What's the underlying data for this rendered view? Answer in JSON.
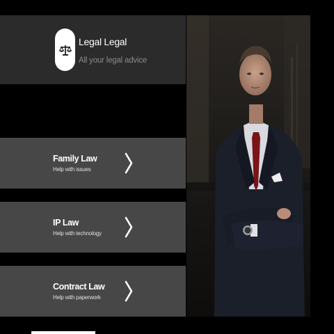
{
  "app": {
    "title": "Legal Legal",
    "tagline": "All your legal advice",
    "logo_icon": "scales-of-justice-icon"
  },
  "photo": {
    "subject": "man in dark suit with red tie, arms crossed",
    "icon": "lawyer-portrait-photo"
  },
  "services": [
    {
      "title": "Family Law",
      "subtitle": "Help with issues",
      "icon": "chevron-right-icon"
    },
    {
      "title": "IP Law",
      "subtitle": "Help with technology",
      "icon": "chevron-right-icon"
    },
    {
      "title": "Contract Law",
      "subtitle": "Help with paperwork",
      "icon": "chevron-right-icon"
    }
  ],
  "colors": {
    "background": "#000000",
    "header": "#2b2b2b",
    "card": "#474747",
    "text_primary": "#ffffff",
    "text_muted": "#8a8a8a"
  }
}
